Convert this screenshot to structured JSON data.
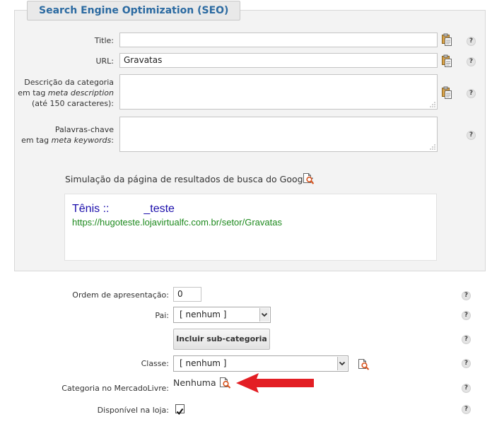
{
  "seo": {
    "legend": "Search Engine Optimization (SEO)",
    "title_label": "Title:",
    "title_value": "",
    "url_label": "URL:",
    "url_value": "Gravatas",
    "description_label_1": "Descrição da categoria",
    "description_label_2_prefix": "em tag ",
    "description_label_2_em": "meta description",
    "description_label_3": "(até 150 caracteres):",
    "keywords_label_1": "Palavras-chave",
    "keywords_label_2_prefix": "em tag ",
    "keywords_label_2_em": "meta keywords",
    "keywords_label_2_suffix": ":",
    "simulation_label": "Simulação da página de resultados de busca do Google:",
    "serp_title": "Tênis ::           _teste",
    "serp_url": "https://hugoteste.lojavirtualfc.com.br/setor/Gravatas"
  },
  "help_glyph": "?",
  "form": {
    "order_label": "Ordem de apresentação:",
    "order_value": "0",
    "parent_label": "Pai:",
    "parent_value": "[ nenhum ]",
    "add_subcategory_button": "Incluir sub-categoria",
    "class_label": "Classe:",
    "class_value": "[ nenhum ]",
    "mercadolivre_label": "Categoria no MercadoLivre:",
    "mercadolivre_value": "Nenhuma",
    "available_label": "Disponível na loja:",
    "available_checked": true
  },
  "colors": {
    "legend_text": "#2b6aa1",
    "serp_title": "#1a0dab",
    "serp_url": "#1e8a1e",
    "arrow": "#e31e24"
  },
  "icons": [
    "paste-icon",
    "search-preview-icon",
    "help-icon",
    "checkmark-icon",
    "red-arrow"
  ]
}
